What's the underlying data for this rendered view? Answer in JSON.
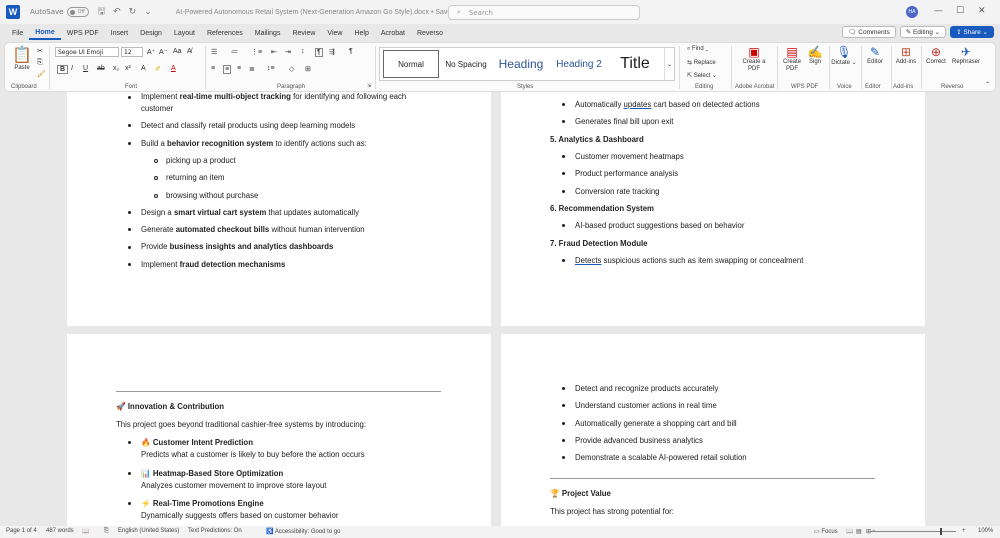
{
  "titlebar": {
    "autosave_label": "AutoSave",
    "autosave_state": "Off",
    "doc_title": "AI-Powered Autonomous Retail System (Next-Generation Amazon Go Style).docx • Saved",
    "search_placeholder": "Search",
    "avatar_initials": "HA"
  },
  "tabs": [
    "File",
    "Home",
    "WPS PDF",
    "Insert",
    "Design",
    "Layout",
    "References",
    "Mailings",
    "Review",
    "View",
    "Help",
    "Acrobat",
    "Reverso"
  ],
  "actions": {
    "comments": "Comments",
    "editing": "Editing",
    "share": "Share"
  },
  "ribbon": {
    "paste": "Paste",
    "clipboard": "Clipboard",
    "font_name": "Segoe UI Emoji",
    "font_size": "12",
    "font": "Font",
    "paragraph": "Paragraph",
    "styles_label": "Styles",
    "styles": [
      "Normal",
      "No Spacing",
      "Heading",
      "Heading 2",
      "Title"
    ],
    "find": "Find",
    "replace": "Replace",
    "select": "Select",
    "editing": "Editing",
    "create_pdf": "Create a PDF",
    "adobe": "Adobe Acrobat",
    "create_pdf2": "Create PDF",
    "sign": "Sign",
    "wps": "WPS PDF",
    "dictate": "Dictate",
    "voice": "Voice",
    "editor": "Editor",
    "editor_group": "Editor",
    "addins": "Add-ins",
    "addins_group": "Add-ins",
    "correct": "Correct",
    "rephraser": "Rephraser",
    "reverso": "Reverso"
  },
  "page1": {
    "items": [
      {
        "pre": "Implement ",
        "bold": "real-time multi-object tracking",
        "post": " for identifying and following each"
      },
      {
        "cont": "customer"
      },
      {
        "pre": "Detect and classify retail products using deep learning models",
        "bold": "",
        "post": ""
      },
      {
        "pre": "Build a ",
        "bold": "behavior recognition system",
        "post": " to identify actions such as:"
      },
      {
        "sub": "picking up a product"
      },
      {
        "sub": "returning an item"
      },
      {
        "sub": "browsing without purchase"
      },
      {
        "pre": "Design a ",
        "bold": "smart virtual cart system",
        "post": " that updates automatically"
      },
      {
        "pre": "Generate ",
        "bold": "automated checkout bills",
        "post": " without human intervention"
      },
      {
        "pre": "Provide ",
        "bold": "business insights and analytics dashboards",
        "post": ""
      },
      {
        "pre": "Implement ",
        "bold": "fraud detection mechanisms",
        "post": ""
      }
    ]
  },
  "page2": {
    "b1_pre": "Automatically ",
    "b1_u": "updates",
    "b1_post": " cart based on detected actions",
    "b2": "Generates final bill upon exit",
    "h5": "5. Analytics & Dashboard",
    "b3": "Customer movement heatmaps",
    "b4": "Product performance analysis",
    "b5": "Conversion rate tracking",
    "h6": "6. Recommendation System",
    "b6": "AI-based product suggestions based on behavior",
    "h7": "7. Fraud Detection Module",
    "b7_u": "Detects",
    "b7_post": " suspicious actions such as item swapping or concealment"
  },
  "page3": {
    "heading_icon": "🚀",
    "heading": "Innovation & Contribution",
    "intro": "This project goes beyond traditional cashier-free systems by introducing:",
    "items": [
      {
        "icon": "🔥",
        "title": "Customer Intent Prediction",
        "desc": "Predicts what a customer is likely to buy before the action occurs"
      },
      {
        "icon": "📊",
        "title": "Heatmap-Based Store Optimization",
        "desc": "Analyzes customer movement to improve store layout"
      },
      {
        "icon": "⚡",
        "title": "Real-Time Promotions Engine",
        "desc": "Dynamically suggests offers based on customer behavior"
      }
    ]
  },
  "page4": {
    "items": [
      "Detect and recognize products accurately",
      "Understand customer actions in real time",
      "Automatically generate a shopping cart and bill",
      "Provide advanced business analytics",
      "Demonstrate a scalable AI-powered retail solution"
    ],
    "heading_icon": "🏆",
    "heading": "Project Value",
    "intro": "This project has strong potential for:"
  },
  "status": {
    "page": "Page 1 of 4",
    "words": "487 words",
    "lang": "English (United States)",
    "predictions": "Text Predictions: On",
    "accessibility": "Accessibility: Good to go",
    "focus": "Focus",
    "zoom": "100%"
  }
}
